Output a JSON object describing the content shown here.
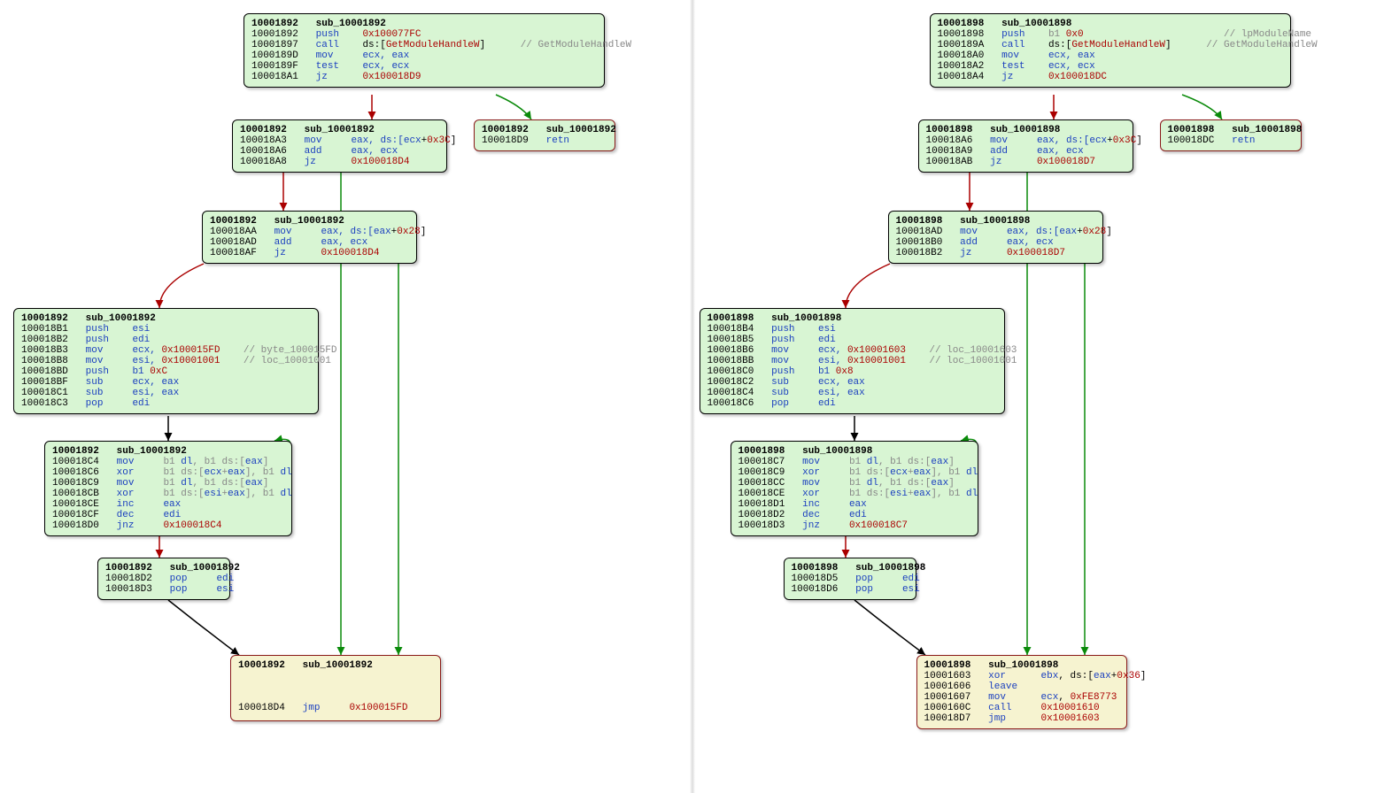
{
  "left": {
    "fn": "sub_10001892",
    "addr": "10001892",
    "b1": {
      "lines": [
        [
          "10001892",
          "push",
          "0x100077FC",
          "",
          ""
        ],
        [
          "10001897",
          "call",
          "ds:[",
          "GetModuleHandleW",
          "]",
          "// GetModuleHandleW"
        ],
        [
          "1000189D",
          "mov",
          "ecx, eax",
          "",
          ""
        ],
        [
          "1000189F",
          "test",
          "ecx, ecx",
          "",
          ""
        ],
        [
          "100018A1",
          "jz",
          "0x100018D9",
          "",
          ""
        ]
      ]
    },
    "b2": {
      "lines": [
        [
          "100018A3",
          "mov",
          "eax, ds:[",
          "ecx",
          "+",
          "0x3C",
          "]"
        ],
        [
          "100018A6",
          "add",
          "eax, ecx",
          "",
          "",
          "",
          ""
        ],
        [
          "100018A8",
          "jz",
          "0x100018D4",
          "",
          "",
          "",
          ""
        ]
      ]
    },
    "b2r": {
      "line": [
        "100018D9",
        "retn"
      ]
    },
    "b3": {
      "lines": [
        [
          "100018AA",
          "mov",
          "eax, ds:[",
          "eax",
          "+",
          "0x28",
          "]"
        ],
        [
          "100018AD",
          "add",
          "eax, ecx",
          "",
          "",
          "",
          ""
        ],
        [
          "100018AF",
          "jz",
          "0x100018D4",
          "",
          "",
          "",
          ""
        ]
      ]
    },
    "b4": {
      "lines": [
        [
          "100018B1",
          "push",
          "esi",
          "",
          ""
        ],
        [
          "100018B2",
          "push",
          "edi",
          "",
          ""
        ],
        [
          "100018B3",
          "mov",
          "ecx, ",
          "0x100015FD",
          "// byte_100015FD"
        ],
        [
          "100018B8",
          "mov",
          "esi, ",
          "0x10001001",
          "// loc_10001001"
        ],
        [
          "100018BD",
          "push",
          "b1 ",
          "0xC",
          ""
        ],
        [
          "100018BF",
          "sub",
          "ecx, eax",
          "",
          ""
        ],
        [
          "100018C1",
          "sub",
          "esi, eax",
          "",
          ""
        ],
        [
          "100018C3",
          "pop",
          "edi",
          "",
          ""
        ]
      ]
    },
    "b5": {
      "lines": [
        [
          "100018C4",
          "mov",
          "b1 ",
          "dl",
          ", b1 ds:[",
          "eax",
          "]"
        ],
        [
          "100018C6",
          "xor",
          "b1 ds:[",
          "ecx",
          "+",
          "eax",
          "], b1 ",
          "dl"
        ],
        [
          "100018C9",
          "mov",
          "b1 ",
          "dl",
          ", b1 ds:[",
          "eax",
          "]"
        ],
        [
          "100018CB",
          "xor",
          "b1 ds:[",
          "esi",
          "+",
          "eax",
          "], b1 ",
          "dl"
        ],
        [
          "100018CE",
          "inc",
          "eax",
          "",
          "",
          "",
          "",
          ""
        ],
        [
          "100018CF",
          "dec",
          "edi",
          "",
          "",
          "",
          "",
          ""
        ],
        [
          "100018D0",
          "jnz",
          "0x100018C4",
          "",
          "",
          "",
          "",
          ""
        ]
      ]
    },
    "b6": {
      "lines": [
        [
          "100018D2",
          "pop",
          "edi"
        ],
        [
          "100018D3",
          "pop",
          "esi"
        ]
      ]
    },
    "b7": {
      "line": [
        "100018D4",
        "jmp",
        "0x100015FD"
      ]
    }
  },
  "right": {
    "fn": "sub_10001898",
    "addr": "10001898",
    "b1": {
      "lines": [
        [
          "10001898",
          "push",
          "b1 ",
          "0x0",
          "// lpModuleName"
        ],
        [
          "1000189A",
          "call",
          "ds:[",
          "GetModuleHandleW",
          "// GetModuleHandleW"
        ],
        [
          "100018A0",
          "mov",
          "ecx, eax",
          "",
          ""
        ],
        [
          "100018A2",
          "test",
          "ecx, ecx",
          "",
          ""
        ],
        [
          "100018A4",
          "jz",
          "0x100018DC",
          "",
          ""
        ]
      ]
    },
    "b2": {
      "lines": [
        [
          "100018A6",
          "mov",
          "eax, ds:[",
          "ecx",
          "+",
          "0x3C",
          "]"
        ],
        [
          "100018A9",
          "add",
          "eax, ecx",
          "",
          "",
          "",
          ""
        ],
        [
          "100018AB",
          "jz",
          "0x100018D7",
          "",
          "",
          "",
          ""
        ]
      ]
    },
    "b2r": {
      "line": [
        "100018DC",
        "retn"
      ]
    },
    "b3": {
      "lines": [
        [
          "100018AD",
          "mov",
          "eax, ds:[",
          "eax",
          "+",
          "0x28",
          "]"
        ],
        [
          "100018B0",
          "add",
          "eax, ecx",
          "",
          "",
          "",
          ""
        ],
        [
          "100018B2",
          "jz",
          "0x100018D7",
          "",
          "",
          "",
          ""
        ]
      ]
    },
    "b4": {
      "lines": [
        [
          "100018B4",
          "push",
          "esi",
          "",
          ""
        ],
        [
          "100018B5",
          "push",
          "edi",
          "",
          ""
        ],
        [
          "100018B6",
          "mov",
          "ecx, ",
          "0x10001603",
          "// loc_10001603"
        ],
        [
          "100018BB",
          "mov",
          "esi, ",
          "0x10001001",
          "// loc_10001001"
        ],
        [
          "100018C0",
          "push",
          "b1 ",
          "0x8",
          ""
        ],
        [
          "100018C2",
          "sub",
          "ecx, eax",
          "",
          ""
        ],
        [
          "100018C4",
          "sub",
          "esi, eax",
          "",
          ""
        ],
        [
          "100018C6",
          "pop",
          "edi",
          "",
          ""
        ]
      ]
    },
    "b5": {
      "lines": [
        [
          "100018C7",
          "mov",
          "b1 ",
          "dl",
          ", b1 ds:[",
          "eax",
          "]"
        ],
        [
          "100018C9",
          "xor",
          "b1 ds:[",
          "ecx",
          "+",
          "eax",
          "], b1 ",
          "dl"
        ],
        [
          "100018CC",
          "mov",
          "b1 ",
          "dl",
          ", b1 ds:[",
          "eax",
          "]"
        ],
        [
          "100018CE",
          "xor",
          "b1 ds:[",
          "esi",
          "+",
          "eax",
          "], b1 ",
          "dl"
        ],
        [
          "100018D1",
          "inc",
          "eax",
          "",
          "",
          "",
          "",
          ""
        ],
        [
          "100018D2",
          "dec",
          "edi",
          "",
          "",
          "",
          "",
          ""
        ],
        [
          "100018D3",
          "jnz",
          "0x100018C7",
          "",
          "",
          "",
          "",
          ""
        ]
      ]
    },
    "b6": {
      "lines": [
        [
          "100018D5",
          "pop",
          "edi"
        ],
        [
          "100018D6",
          "pop",
          "esi"
        ]
      ]
    },
    "b7": {
      "lines": [
        [
          "10001603",
          "xor",
          "ebx",
          ", ds:[",
          "eax",
          "+",
          "0x36",
          "]"
        ],
        [
          "10001606",
          "leave",
          "",
          "",
          "",
          "",
          "",
          ""
        ],
        [
          "10001607",
          "mov",
          "ecx",
          ", ",
          "",
          "",
          "0xFE8773",
          ""
        ],
        [
          "1000160C",
          "call",
          "",
          "",
          "",
          "",
          "0x10001610",
          ""
        ],
        [
          "100018D7",
          "jmp",
          "",
          "",
          "",
          "",
          "0x10001603",
          ""
        ]
      ]
    }
  }
}
